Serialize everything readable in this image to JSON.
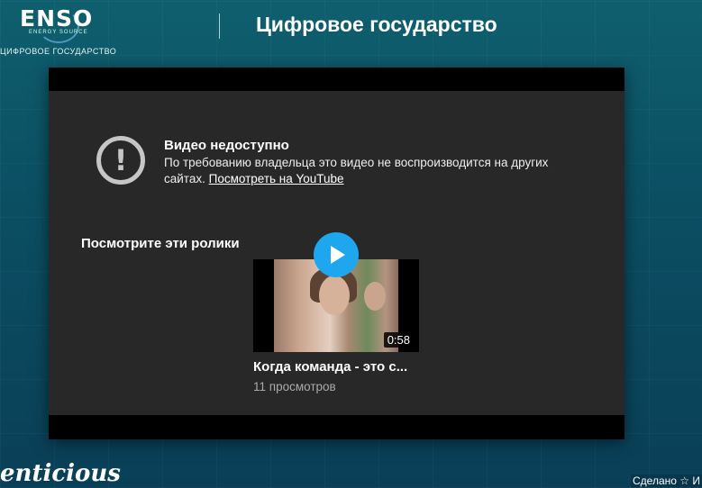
{
  "header": {
    "logo_text": "ENSO",
    "logo_subtext": "ENERGY SOURCE",
    "logo_tagline": "ЦИФРОВОЕ ГОСУДАРСТВО",
    "title": "Цифровое государство"
  },
  "player": {
    "error_icon": "!",
    "error_title": "Видео недоступно",
    "error_text": "По требованию владельца это видео не воспроизводится на других сайтах.",
    "error_link": "Посмотреть на YouTube",
    "suggest_heading": "Посмотрите эти ролики",
    "suggestion": {
      "duration": "0:58",
      "title": "Когда команда - это с...",
      "views": "11 просмотров"
    }
  },
  "footer": {
    "brand": "enticious",
    "made_with": "Сделано ☆ И"
  },
  "colors": {
    "play_button": "#1ea7ee",
    "player_bg": "#282828"
  }
}
